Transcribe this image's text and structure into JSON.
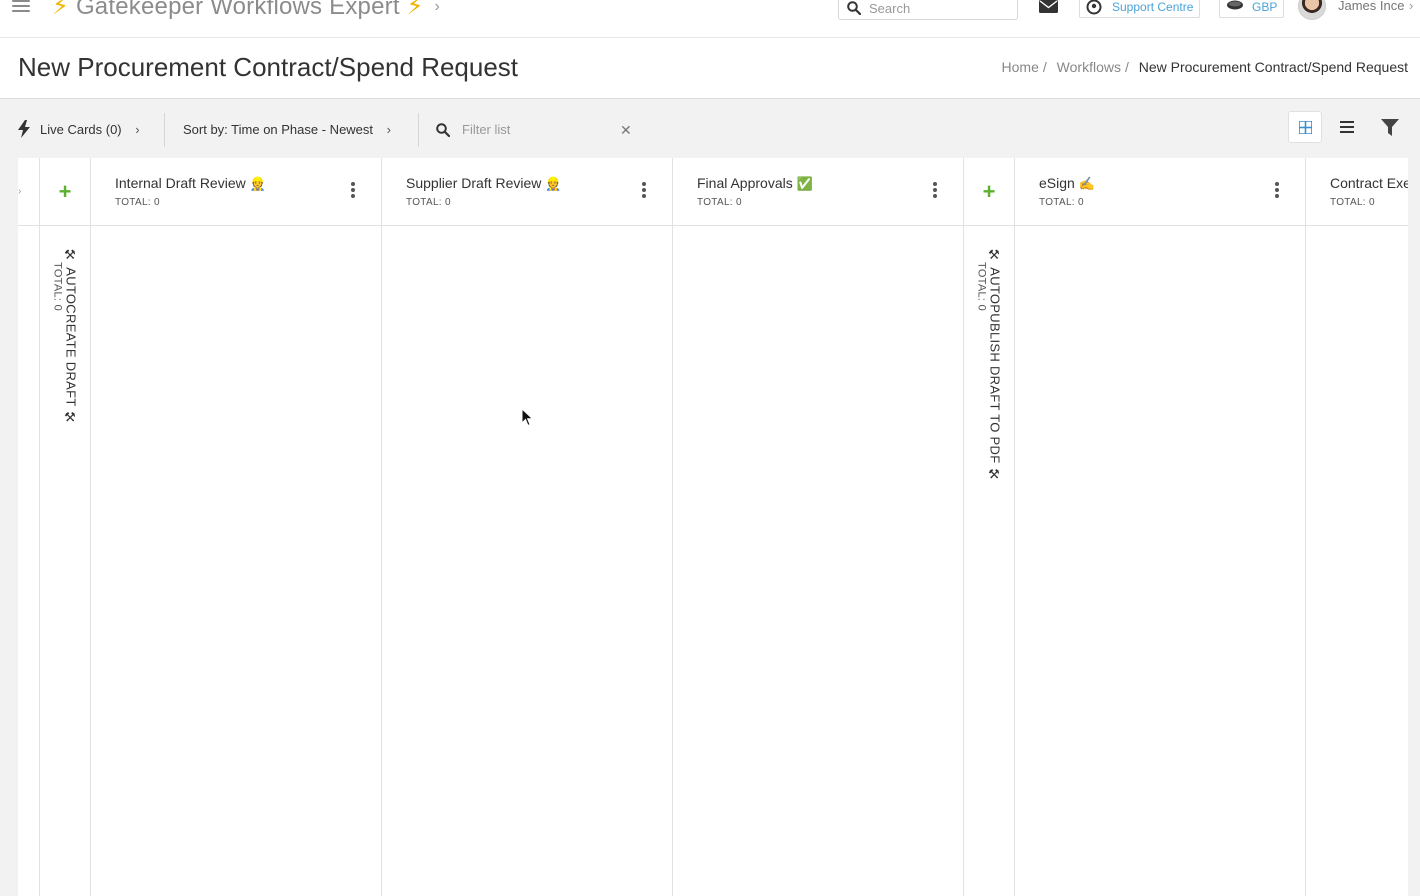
{
  "topnav": {
    "app_title": "Gatekeeper Workflows Expert",
    "bolt_glyph": "⚡",
    "search_placeholder": "Search",
    "support_label": "Support Centre",
    "currency_label": "GBP",
    "user_name": "James Ince"
  },
  "header": {
    "title": "New Procurement Contract/Spend Request",
    "breadcrumb": [
      {
        "label": "Home"
      },
      {
        "label": "Workflows"
      },
      {
        "label": "New Procurement Contract/Spend Request"
      }
    ],
    "breadcrumb_sep": "/"
  },
  "toolbar": {
    "live_cards": "Live Cards (0)",
    "sort_by": "Sort by: Time on Phase - Newest",
    "filter_placeholder": "Filter list",
    "clear_glyph": "✕"
  },
  "board": {
    "automations": [
      {
        "label": "AUTOCREATE DRAFT",
        "total": "TOTAL: 0",
        "icon": "tools-icon"
      },
      {
        "label": "AUTOPUBLISH DRAFT TO PDF",
        "total": "TOTAL: 0",
        "icon": "tools-icon"
      }
    ],
    "phases": [
      {
        "title": "Internal Draft Review",
        "emoji": "👷",
        "total": "TOTAL: 0"
      },
      {
        "title": "Supplier Draft Review",
        "emoji": "👷",
        "total": "TOTAL: 0"
      },
      {
        "title": "Final Approvals",
        "emoji": "✅",
        "total": "TOTAL: 0"
      },
      {
        "title": "eSign",
        "emoji": "✍️",
        "total": "TOTAL: 0"
      },
      {
        "title": "Contract Exe",
        "emoji": "",
        "total": "TOTAL: 0"
      }
    ],
    "add_glyph": "+",
    "tools_glyph": "⚒"
  },
  "colors": {
    "accent_blue": "#4aa3d8",
    "add_green": "#5cb030",
    "bolt_yellow": "#f0b400",
    "board_bg": "#f2f2f2"
  }
}
